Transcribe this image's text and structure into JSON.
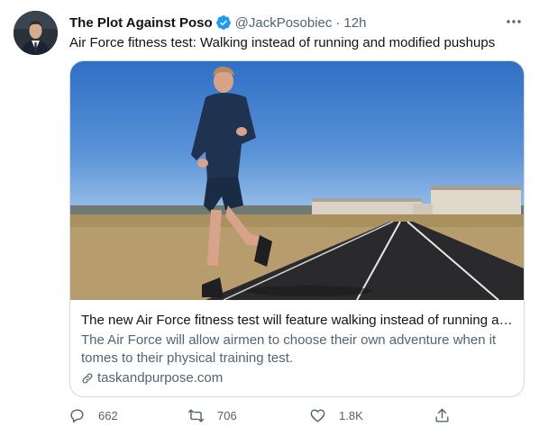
{
  "tweet": {
    "display_name": "The Plot Against Poso",
    "handle": "@JackPosobiec",
    "separator": "·",
    "time": "12h",
    "text": "Air Force fitness test: Walking instead of running and modified pushups"
  },
  "card": {
    "title": "The new Air Force fitness test will feature walking instead of running an...",
    "description": "The Air Force will allow airmen to choose their own adventure when it tomes to their physical training test.",
    "domain": "taskandpurpose.com"
  },
  "actions": {
    "replies": "662",
    "retweets": "706",
    "likes": "1.8K"
  },
  "colors": {
    "verified": "#1d9bf0",
    "secondary_text": "#536471",
    "border": "#cfd9de"
  },
  "icons": [
    "verified-badge-icon",
    "more-icon",
    "link-icon",
    "reply-icon",
    "retweet-icon",
    "like-icon",
    "share-icon"
  ]
}
